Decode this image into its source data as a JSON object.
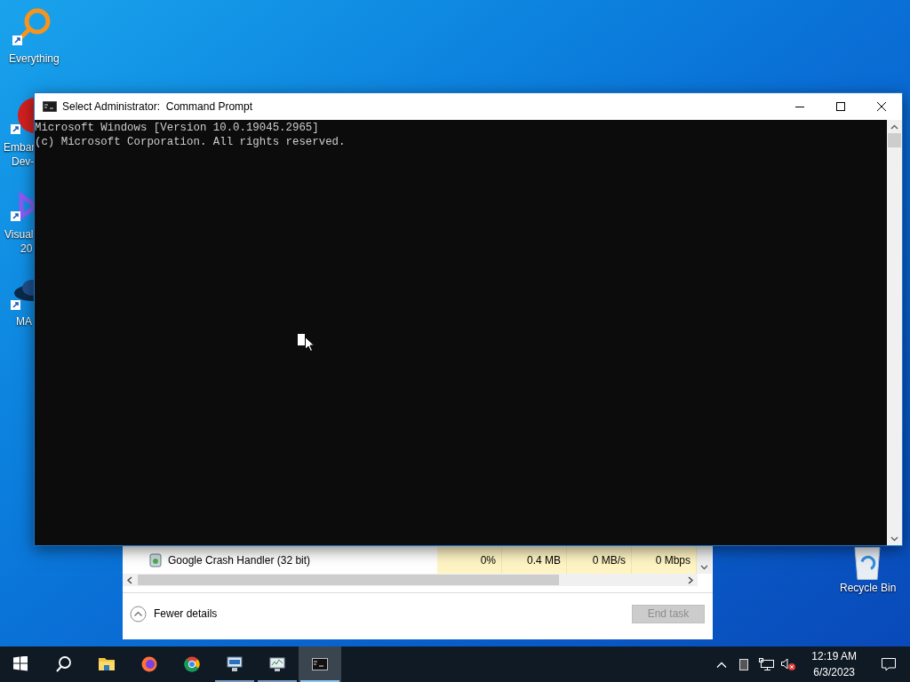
{
  "desktop_icons": [
    {
      "kind": "everything",
      "lines": [
        "Everything"
      ]
    },
    {
      "kind": "devcpp",
      "lines": [
        "Embar",
        "Dev-"
      ]
    },
    {
      "kind": "visualstudio",
      "lines": [
        "Visual",
        "20"
      ]
    },
    {
      "kind": "hat",
      "lines": [
        "MA"
      ]
    },
    {
      "kind": "recycle",
      "lines": [
        "Recycle Bin"
      ]
    }
  ],
  "cmd_window": {
    "title": "Select Administrator:  Command Prompt",
    "lines": [
      "Microsoft Windows [Version 10.0.19045.2965]",
      "(c) Microsoft Corporation. All rights reserved."
    ]
  },
  "task_manager": {
    "row": {
      "name": "Google Crash Handler (32 bit)",
      "cells": [
        "0%",
        "0.4 MB",
        "0 MB/s",
        "0 Mbps"
      ]
    },
    "fewer_details": "Fewer details",
    "end_task": {
      "label": "End task",
      "disabled": true
    }
  },
  "taskbar": {
    "items": [
      {
        "kind": "start",
        "running": false,
        "active": false
      },
      {
        "kind": "search",
        "running": false,
        "active": false
      },
      {
        "kind": "explorer",
        "running": false,
        "active": false
      },
      {
        "kind": "firefox",
        "running": false,
        "active": false
      },
      {
        "kind": "chrome",
        "running": false,
        "active": false
      },
      {
        "kind": "monitor",
        "running": true,
        "active": false
      },
      {
        "kind": "perf",
        "running": true,
        "active": false
      },
      {
        "kind": "cmd",
        "running": true,
        "active": true
      }
    ],
    "time": "12:19 AM",
    "date": "6/3/2023"
  }
}
